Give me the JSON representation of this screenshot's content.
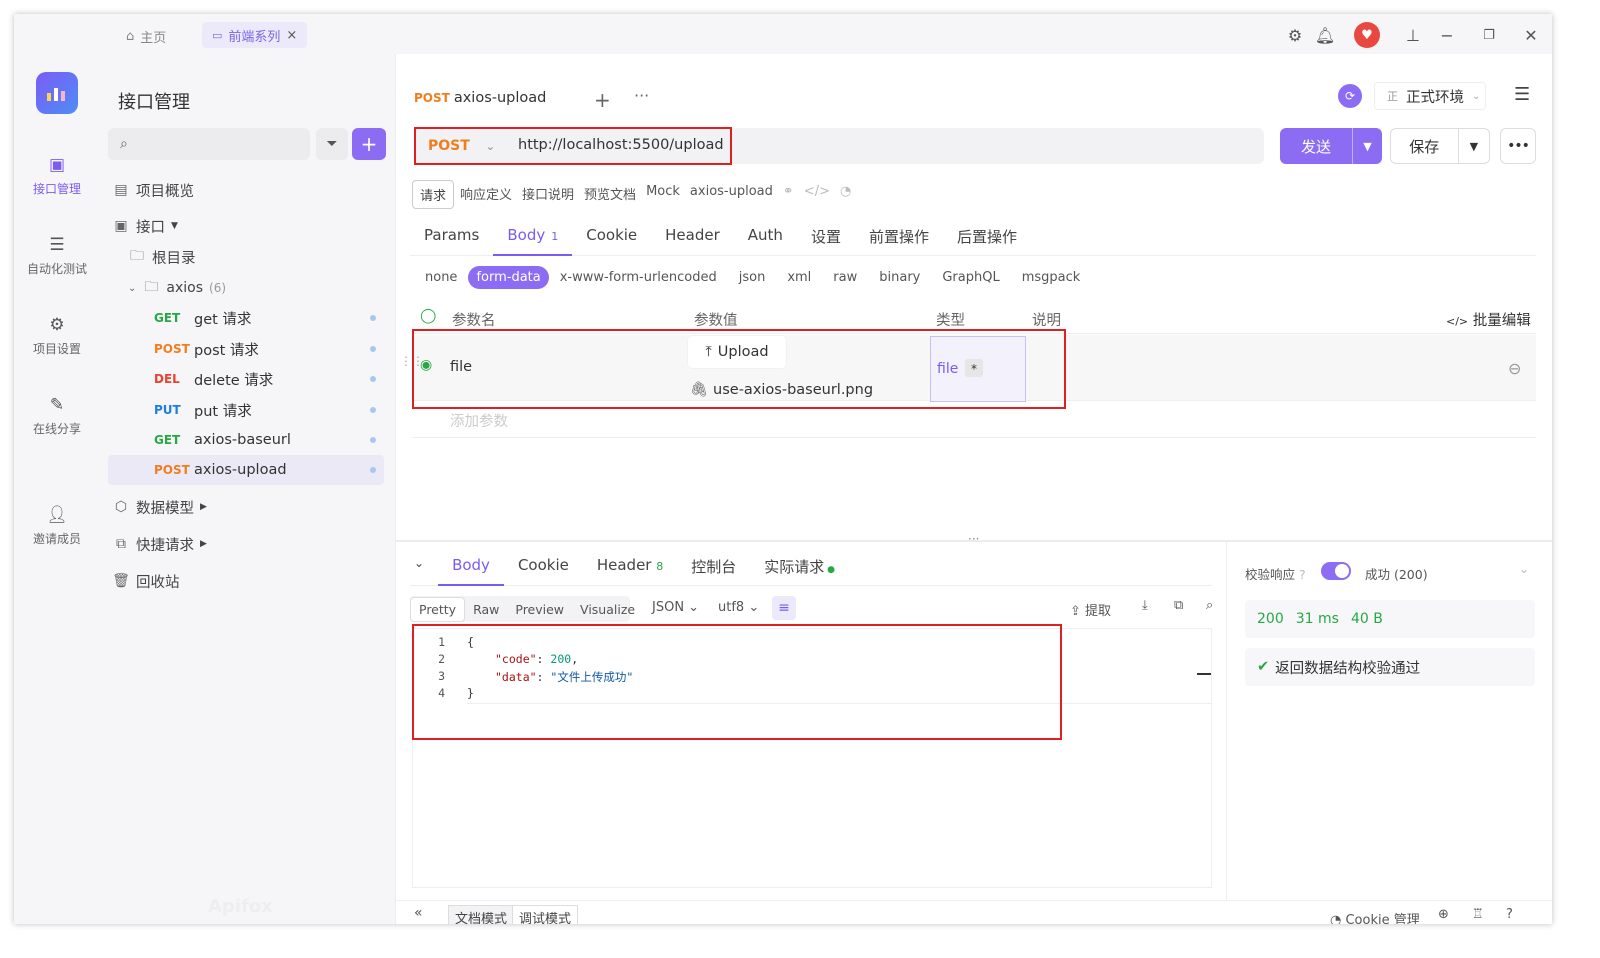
{
  "titlebar": {
    "home_label": "主页",
    "series_tab": "前端系列",
    "close_glyph": "×"
  },
  "rail": {
    "items": [
      {
        "label": "接口管理"
      },
      {
        "label": "自动化测试"
      },
      {
        "label": "项目设置"
      },
      {
        "label": "在线分享"
      },
      {
        "label": "邀请成员"
      }
    ]
  },
  "tree": {
    "title": "接口管理",
    "overview": "项目概览",
    "apis": "接口",
    "root": "根目录",
    "folder": "axios",
    "folder_count": "(6)",
    "items": [
      {
        "method": "GET",
        "name": "get 请求"
      },
      {
        "method": "POST",
        "name": "post 请求"
      },
      {
        "method": "DEL",
        "name": "delete 请求"
      },
      {
        "method": "PUT",
        "name": "put 请求"
      },
      {
        "method": "GET",
        "name": "axios-baseurl"
      },
      {
        "method": "POST",
        "name": "axios-upload"
      }
    ],
    "data_model": "数据模型",
    "quick_req": "快捷请求",
    "trash": "回收站",
    "watermark": "Apifox"
  },
  "main": {
    "tab": {
      "method": "POST",
      "name": "axios-upload"
    },
    "env": {
      "badge": "正",
      "label": "正式环境"
    },
    "method": "POST",
    "url": "http://localhost:5500/upload",
    "send": "发送",
    "save": "保存",
    "subtabs": [
      "请求",
      "响应定义",
      "接口说明",
      "预览文档",
      "Mock"
    ],
    "subtab_name": "axios-upload",
    "param_tabs": [
      {
        "label": "Params"
      },
      {
        "label": "Body",
        "count": "1"
      },
      {
        "label": "Cookie"
      },
      {
        "label": "Header"
      },
      {
        "label": "Auth"
      },
      {
        "label": "设置"
      },
      {
        "label": "前置操作"
      },
      {
        "label": "后置操作"
      }
    ],
    "body_types": [
      "none",
      "form-data",
      "x-www-form-urlencoded",
      "json",
      "xml",
      "raw",
      "binary",
      "GraphQL",
      "msgpack"
    ],
    "table_headers": {
      "name": "参数名",
      "value": "参数值",
      "type": "类型",
      "desc": "说明",
      "bulk": "批量编辑"
    },
    "row": {
      "name": "file",
      "upload": "Upload",
      "filename": "use-axios-baseurl.png",
      "type": "file",
      "required": "*"
    },
    "add_param": "添加参数"
  },
  "response": {
    "tabs": [
      {
        "label": "Body"
      },
      {
        "label": "Cookie"
      },
      {
        "label": "Header",
        "count": "8"
      },
      {
        "label": "控制台"
      },
      {
        "label": "实际请求"
      }
    ],
    "view_modes": [
      "Pretty",
      "Raw",
      "Preview",
      "Visualize"
    ],
    "format": "JSON",
    "encoding": "utf8",
    "extract": "提取",
    "code_lines": [
      {
        "n": "1",
        "t": "{"
      },
      {
        "n": "2",
        "key": "\"code\"",
        "val": "200",
        "tail": ","
      },
      {
        "n": "3",
        "key": "\"data\"",
        "sval": "\"文件上传成功\""
      },
      {
        "n": "4",
        "t": "}"
      }
    ],
    "validate_label": "校验响应",
    "validate_status": "成功 (200)",
    "status": "200",
    "time": "31 ms",
    "size": "40 B",
    "validation_msg": "返回数据结构校验通过"
  },
  "footer": {
    "doc_mode": "文档模式",
    "debug_mode": "调试模式",
    "cookie_mgr": "Cookie 管理"
  },
  "colors": {
    "accent": "#8b6cf3",
    "highlight": "#e02020",
    "get": "#27a844",
    "post": "#f07d1e"
  }
}
